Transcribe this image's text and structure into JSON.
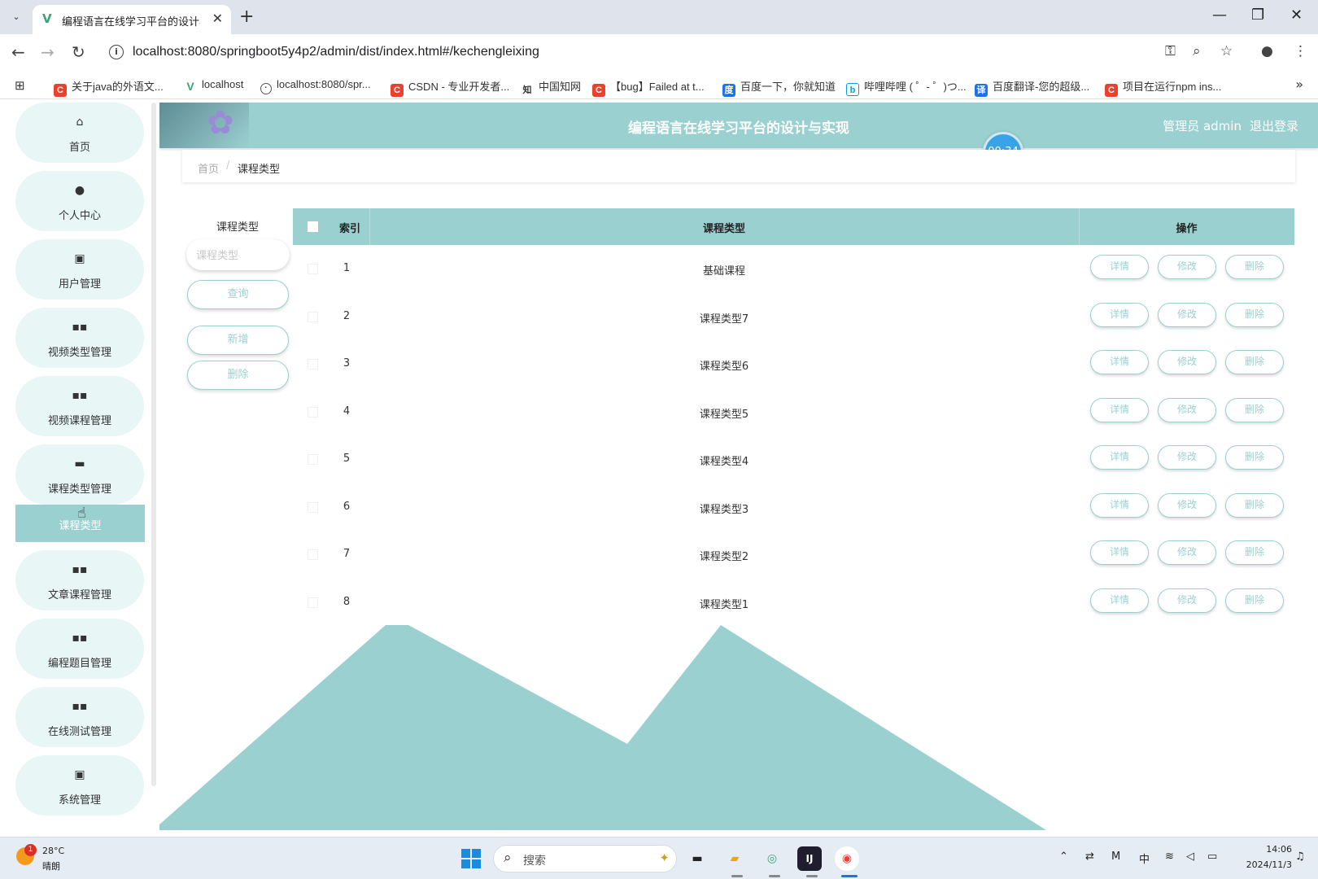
{
  "browser": {
    "tab_title": "编程语言在线学习平台的设计与实现",
    "url": "localhost:8080/springboot5y4p2/admin/dist/index.html#/kechengleixing",
    "bookmarks": [
      {
        "label": "关于java的外语文...",
        "icon": "csdn-icon"
      },
      {
        "label": "localhost",
        "icon": "vue-icon"
      },
      {
        "label": "localhost:8080/spr...",
        "icon": "globe-icon"
      },
      {
        "label": "CSDN - 专业开发者...",
        "icon": "csdn-icon"
      },
      {
        "label": "中国知网",
        "icon": "cnki-icon"
      },
      {
        "label": "【bug】Failed at t...",
        "icon": "csdn-icon"
      },
      {
        "label": "百度一下，你就知道",
        "icon": "baidu-icon"
      },
      {
        "label": "哔哩哔哩 ( ゜- ゜)つ...",
        "icon": "bilibili-icon"
      },
      {
        "label": "百度翻译-您的超级...",
        "icon": "translate-icon"
      },
      {
        "label": "项目在运行npm ins...",
        "icon": "csdn-icon"
      }
    ]
  },
  "sidebar": {
    "items": [
      {
        "label": "首页",
        "icon": "home-icon",
        "glyph": "⌂"
      },
      {
        "label": "个人中心",
        "icon": "user-icon",
        "glyph": "●"
      },
      {
        "label": "用户管理",
        "icon": "clipboard-icon",
        "glyph": "▣"
      },
      {
        "label": "视频类型管理",
        "icon": "grid-icon",
        "glyph": "▪▪"
      },
      {
        "label": "视频课程管理",
        "icon": "grid-icon",
        "glyph": "▪▪"
      },
      {
        "label": "课程类型管理",
        "icon": "briefcase-icon",
        "glyph": "▬"
      },
      {
        "label": "文章课程管理",
        "icon": "grid-icon",
        "glyph": "▪▪"
      },
      {
        "label": "编程题目管理",
        "icon": "grid-icon",
        "glyph": "▪▪"
      },
      {
        "label": "在线测试管理",
        "icon": "grid-icon",
        "glyph": "▪▪"
      },
      {
        "label": "系统管理",
        "icon": "check-clipboard-icon",
        "glyph": "▣"
      }
    ],
    "active_sub_item": "课程类型"
  },
  "header": {
    "title": "编程语言在线学习平台的设计与实现",
    "user_label": "管理员 admin",
    "logout_label": "退出登录",
    "timer": "00:34"
  },
  "breadcrumb": {
    "home": "首页",
    "separator": "/",
    "current": "课程类型"
  },
  "search": {
    "label": "课程类型",
    "placeholder": "课程类型",
    "value": "",
    "query_button": "查询",
    "add_button": "新增",
    "delete_button": "删除"
  },
  "table": {
    "columns": [
      "索引",
      "课程类型",
      "操作"
    ],
    "rows": [
      {
        "index": "1",
        "type": "基础课程"
      },
      {
        "index": "2",
        "type": "课程类型7"
      },
      {
        "index": "3",
        "type": "课程类型6"
      },
      {
        "index": "4",
        "type": "课程类型5"
      },
      {
        "index": "5",
        "type": "课程类型4"
      },
      {
        "index": "6",
        "type": "课程类型3"
      },
      {
        "index": "7",
        "type": "课程类型2"
      },
      {
        "index": "8",
        "type": "课程类型1"
      }
    ],
    "row_actions": [
      "详情",
      "修改",
      "删除"
    ]
  },
  "taskbar": {
    "weather_temp": "28°C",
    "weather_desc": "晴朗",
    "weather_badge": "1",
    "search_placeholder": "搜索",
    "ime": "中",
    "time": "14:06",
    "date": "2024/11/3"
  },
  "colors": {
    "accent": "#9bd0d1",
    "accent_light": "#e8f6f5",
    "timer": "#3aa2e6"
  }
}
